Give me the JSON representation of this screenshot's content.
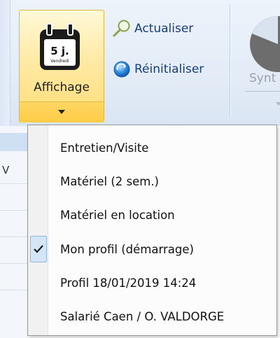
{
  "ribbon": {
    "affichage_label": "Affichage",
    "calendar_day": "5 j.",
    "calendar_weekday": "Vendredi",
    "refresh_label": "Actualiser",
    "reset_label": "Réinitialiser",
    "synt_label": "Synt"
  },
  "menu": {
    "items": [
      {
        "label": "Entretien/Visite",
        "checked": false
      },
      {
        "label": "Matériel (2 sem.)",
        "checked": false
      },
      {
        "label": "Matériel en location",
        "checked": false
      },
      {
        "label": "Mon profil (démarrage)",
        "checked": true
      },
      {
        "label": "Profil 18/01/2019 14:24",
        "checked": false
      },
      {
        "label": "Salarié Caen / O. VALDORGE",
        "checked": false
      }
    ]
  },
  "background": {
    "glyph": "V"
  },
  "colors": {
    "highlight": "#ffdc76",
    "highlight_border": "#e3b640",
    "link_text": "#163e7a",
    "check_bg": "#d5e5f8"
  }
}
